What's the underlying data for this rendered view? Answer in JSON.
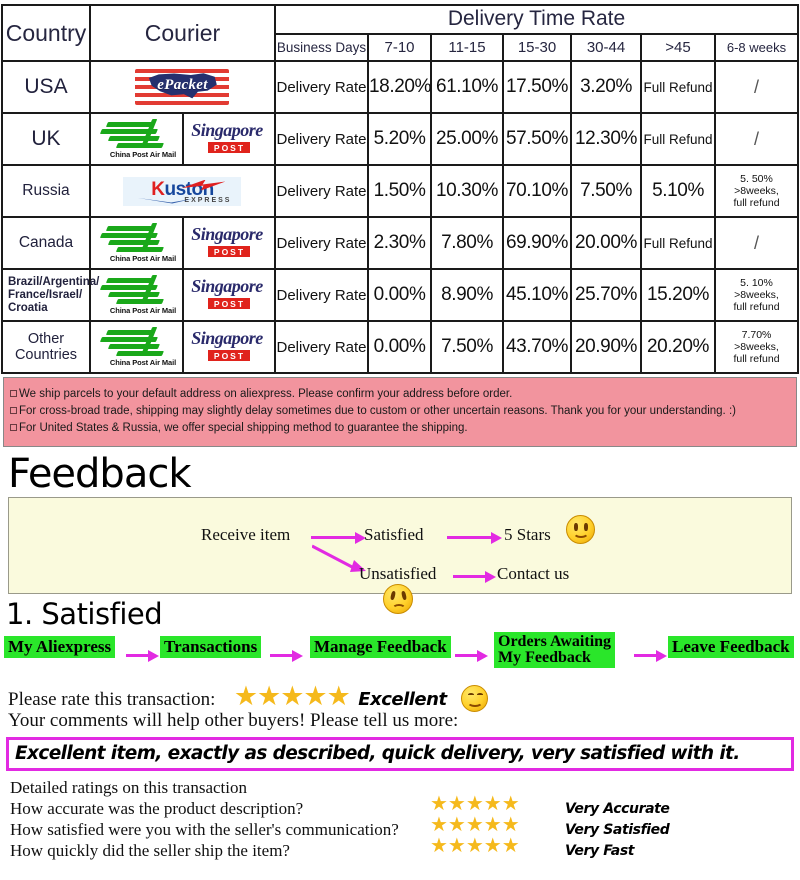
{
  "shipping_table": {
    "headers": {
      "country": "Country",
      "courier": "Courier",
      "delivery_time_rate": "Delivery Time Rate",
      "business_days": "Business Days",
      "ranges": [
        "7-10",
        "11-15",
        "15-30",
        "30-44",
        ">45",
        "6-8 weeks"
      ]
    },
    "row_label": "Delivery Rate",
    "rows": [
      {
        "country": "USA",
        "couriers": [
          "epacket"
        ],
        "label": "Delivery Rate",
        "values": [
          "18.20%",
          "61.10%",
          "17.50%",
          "3.20%",
          "Full Refund",
          "/"
        ]
      },
      {
        "country": "UK",
        "couriers": [
          "china-post-air-mail",
          "singapore-post"
        ],
        "label": "Delivery Rate",
        "values": [
          "5.20%",
          "25.00%",
          "57.50%",
          "12.30%",
          "Full Refund",
          "/"
        ]
      },
      {
        "country": "Russia",
        "couriers": [
          "kuston-express"
        ],
        "label": "Delivery Rate",
        "values": [
          "1.50%",
          "10.30%",
          "70.10%",
          "7.50%",
          "5.10%",
          "5. 50%\n>8weeks,\nfull refund"
        ]
      },
      {
        "country": "Canada",
        "couriers": [
          "china-post-air-mail",
          "singapore-post"
        ],
        "label": "Delivery Rate",
        "values": [
          "2.30%",
          "7.80%",
          "69.90%",
          "20.00%",
          "Full Refund",
          "/"
        ]
      },
      {
        "country": "Brazil/Argentina/\nFrance/Israel/\nCroatia",
        "couriers": [
          "china-post-air-mail",
          "singapore-post"
        ],
        "label": "Delivery Rate",
        "values": [
          "0.00%",
          "8.90%",
          "45.10%",
          "25.70%",
          "15.20%",
          "5. 10%\n>8weeks,\nfull refund"
        ]
      },
      {
        "country": "Other Countries",
        "couriers": [
          "china-post-air-mail",
          "singapore-post"
        ],
        "label": "Delivery Rate",
        "values": [
          "0.00%",
          "7.50%",
          "43.70%",
          "20.90%",
          "20.20%",
          "7.70%\n>8weeks,\nfull refund"
        ]
      }
    ],
    "logos": {
      "epacket": "ePacket",
      "china_post": "China Post Air Mail",
      "singapore_post_script": "Singapore",
      "singapore_post_badge": "POST",
      "kuston_k": "K",
      "kuston_uston": "uston",
      "kuston_express": "EXPRESS"
    },
    "colors": {
      "header_bg": "#f0eda5",
      "country_bg": "#b4aedb",
      "border": "#1a1a1a"
    }
  },
  "notice": {
    "bg": "#f2949e",
    "lines": [
      "We ship parcels to your default address on aliexpress. Please confirm your address before order.",
      "For cross-broad trade, shipping may slightly delay sometimes due to custom or other uncertain reasons. Thank you for your understanding. :)",
      "For United States & Russia, we offer special shipping method to guarantee the shipping."
    ]
  },
  "feedback": {
    "title": "Feedback",
    "box_bg": "#fafadd",
    "arrow_color": "#e22ae2",
    "flow": {
      "receive_item": "Receive item",
      "satisfied": "Satisfied",
      "five_stars": "5 Stars",
      "unsatisfied": "Unsatisfied",
      "contact_us": "Contact us"
    }
  },
  "satisfied": {
    "heading": "1. Satisfied",
    "steps": [
      "My Aliexpress",
      "Transactions",
      "Manage Feedback",
      "Orders Awaiting\nMy Feedback",
      "Leave Feedback"
    ],
    "step_bg": "#2ae62a",
    "rate_prompt": "Please rate this transaction:",
    "rate_stars": "★★★★★",
    "rate_word": "Excellent",
    "comments_prompt": "Your comments will help other buyers! Please tell us more:",
    "comment_text": "Excellent item, exactly as described, quick delivery, very satisfied with it.",
    "comment_border": "#e22ae2",
    "details_title": "Detailed ratings on this transaction",
    "details": [
      {
        "question": "How accurate was the product description?",
        "stars": "★★★★★",
        "verdict": "Very Accurate"
      },
      {
        "question": "How satisfied were you with the seller's communication?",
        "stars": "★★★★★",
        "verdict": "Very Satisfied"
      },
      {
        "question": "How quickly did the seller ship the item?",
        "stars": "★★★★★",
        "verdict": "Very Fast"
      }
    ],
    "star_color": "#f5b91c"
  }
}
